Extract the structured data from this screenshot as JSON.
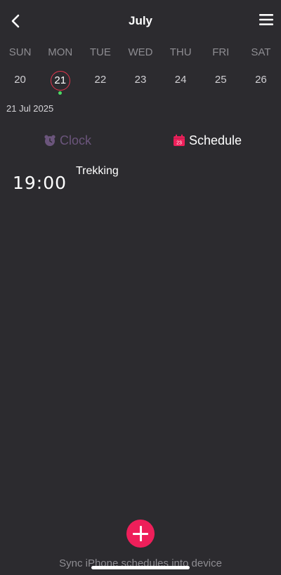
{
  "header": {
    "title": "July",
    "back_icon": "chevron-left-icon",
    "menu_icon": "hamburger-menu-icon"
  },
  "calendar": {
    "weekdays": [
      "SUN",
      "MON",
      "TUE",
      "WED",
      "THU",
      "FRI",
      "SAT"
    ],
    "dates": [
      "20",
      "21",
      "22",
      "23",
      "24",
      "25",
      "26"
    ],
    "selected_date": "21",
    "selected_label": "21 Jul 2025",
    "event_dot_color": "#4cd964",
    "selection_ring_color": "#e2354d"
  },
  "tabs": {
    "clock_label": "Clock",
    "clock_icon": "alarm-clock-icon",
    "schedule_label": "Schedule",
    "schedule_icon": "calendar-icon",
    "schedule_icon_number": "23",
    "active": "Schedule"
  },
  "events": [
    {
      "time": "19:00",
      "title": "Trekking"
    }
  ],
  "footer": {
    "add_icon": "plus-icon",
    "add_button_color": "#ee1f5a",
    "sync_text": "Sync iPhone schedules into device"
  }
}
